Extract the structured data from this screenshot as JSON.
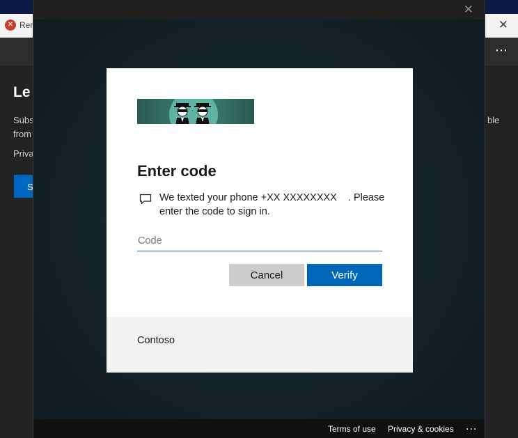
{
  "background_app": {
    "title": "Ren",
    "close_glyph": "✕",
    "more_glyph": "⋯",
    "heading": "Le",
    "line1": "Subs",
    "line2": "from",
    "line3": "Priva",
    "right_text": "ble",
    "button_label": "S"
  },
  "overlay": {
    "close_glyph": "✕",
    "footer": {
      "terms": "Terms of use",
      "privacy": "Privacy & cookies",
      "more": "..."
    }
  },
  "dialog": {
    "title": "Enter code",
    "message_line1": "We texted your phone",
    "phone": "+XX XXXXXXXX",
    "message_line1_end": ". Please",
    "message_line2": "enter the code to sign in.",
    "code_placeholder": "Code",
    "code_value": "",
    "cancel_label": "Cancel",
    "verify_label": "Verify",
    "organization": "Contoso"
  },
  "icons": {
    "app_icon": "app-icon",
    "message": "message-icon",
    "banner": "banner-logo"
  },
  "colors": {
    "accent": "#0067b8",
    "cancel_button": "#cccccc",
    "card_background": "#ffffff",
    "card_footer": "#f2f2f2"
  }
}
